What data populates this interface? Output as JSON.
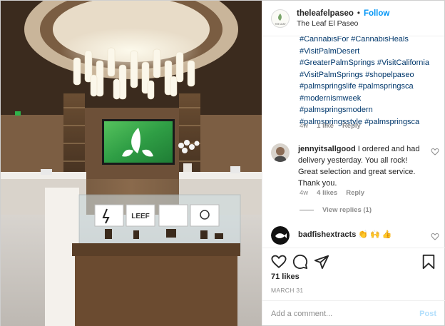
{
  "header": {
    "username": "theleafelpaseo",
    "separator": "•",
    "follow_label": "Follow",
    "location": "The Leaf El Paseo",
    "logo_text": "THE LEAF"
  },
  "photo": {
    "screen_logo_icon": "leaf-icon",
    "display_sign": "LEEF"
  },
  "caption": {
    "hashtag_lines": [
      "#CannabisFor #CannabisHeals",
      "#VisitPalmDesert",
      "#GreaterPalmSprings #VisitCalifornia",
      "#VisitPalmSprings #shopelpaseo",
      "#palmspringslife #palmspringsca",
      "#modernismweek",
      "#palmspringsmodern",
      "#palmspringsstyle #palmspringsca"
    ],
    "age": "4w",
    "likes": "1 like",
    "reply_label": "Reply"
  },
  "comments": [
    {
      "username": "jennyitsallgood",
      "text": "I ordered and had delivery yesterday. You all rock! Great selection and great service. Thank you.",
      "age": "4w",
      "likes": "4 likes",
      "reply_label": "Reply",
      "view_replies": "View replies (1)"
    },
    {
      "username": "badfishextracts",
      "text": "👏 🙌 👍"
    }
  ],
  "actions": {
    "icons": [
      "heart-icon",
      "comment-icon",
      "share-icon",
      "bookmark-icon"
    ],
    "likes_count": "71 likes",
    "date": "MARCH 31",
    "comment_placeholder": "Add a comment...",
    "post_label": "Post"
  },
  "colors": {
    "link_blue": "#0095f6",
    "hashtag_blue": "#00376b",
    "muted_gray": "#8e8e8e",
    "post_disabled": "#b2dffc",
    "screen_green": "#2fa54a"
  }
}
